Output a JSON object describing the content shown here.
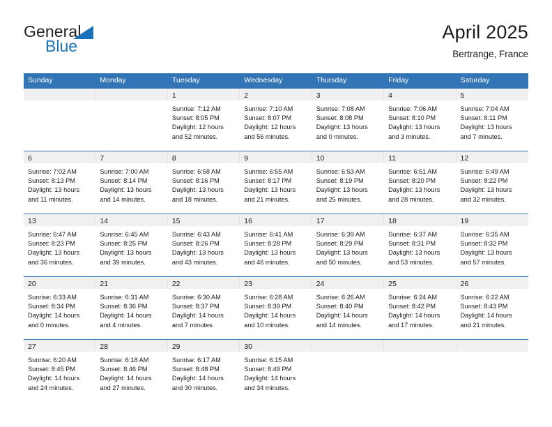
{
  "logo": {
    "primary_text": "General",
    "secondary_text": "Blue",
    "accent_color": "#1b72b8",
    "triangle_icon": "triangle-icon"
  },
  "header": {
    "title": "April 2025",
    "location": "Bertrange, France"
  },
  "theme": {
    "header_blue": "#3275b6",
    "date_band_gray": "#f0f0f0",
    "text_color": "#1a1a1a"
  },
  "calendar": {
    "day_names": [
      "Sunday",
      "Monday",
      "Tuesday",
      "Wednesday",
      "Thursday",
      "Friday",
      "Saturday"
    ],
    "weeks": [
      [
        {
          "date": "",
          "info": ""
        },
        {
          "date": "",
          "info": ""
        },
        {
          "date": "1",
          "info": "Sunrise: 7:12 AM\nSunset: 8:05 PM\nDaylight: 12 hours\nand 52 minutes."
        },
        {
          "date": "2",
          "info": "Sunrise: 7:10 AM\nSunset: 8:07 PM\nDaylight: 12 hours\nand 56 minutes."
        },
        {
          "date": "3",
          "info": "Sunrise: 7:08 AM\nSunset: 8:08 PM\nDaylight: 13 hours\nand 0 minutes."
        },
        {
          "date": "4",
          "info": "Sunrise: 7:06 AM\nSunset: 8:10 PM\nDaylight: 13 hours\nand 3 minutes."
        },
        {
          "date": "5",
          "info": "Sunrise: 7:04 AM\nSunset: 8:11 PM\nDaylight: 13 hours\nand 7 minutes."
        }
      ],
      [
        {
          "date": "6",
          "info": "Sunrise: 7:02 AM\nSunset: 8:13 PM\nDaylight: 13 hours\nand 11 minutes."
        },
        {
          "date": "7",
          "info": "Sunrise: 7:00 AM\nSunset: 8:14 PM\nDaylight: 13 hours\nand 14 minutes."
        },
        {
          "date": "8",
          "info": "Sunrise: 6:58 AM\nSunset: 8:16 PM\nDaylight: 13 hours\nand 18 minutes."
        },
        {
          "date": "9",
          "info": "Sunrise: 6:55 AM\nSunset: 8:17 PM\nDaylight: 13 hours\nand 21 minutes."
        },
        {
          "date": "10",
          "info": "Sunrise: 6:53 AM\nSunset: 8:19 PM\nDaylight: 13 hours\nand 25 minutes."
        },
        {
          "date": "11",
          "info": "Sunrise: 6:51 AM\nSunset: 8:20 PM\nDaylight: 13 hours\nand 28 minutes."
        },
        {
          "date": "12",
          "info": "Sunrise: 6:49 AM\nSunset: 8:22 PM\nDaylight: 13 hours\nand 32 minutes."
        }
      ],
      [
        {
          "date": "13",
          "info": "Sunrise: 6:47 AM\nSunset: 8:23 PM\nDaylight: 13 hours\nand 36 minutes."
        },
        {
          "date": "14",
          "info": "Sunrise: 6:45 AM\nSunset: 8:25 PM\nDaylight: 13 hours\nand 39 minutes."
        },
        {
          "date": "15",
          "info": "Sunrise: 6:43 AM\nSunset: 8:26 PM\nDaylight: 13 hours\nand 43 minutes."
        },
        {
          "date": "16",
          "info": "Sunrise: 6:41 AM\nSunset: 8:28 PM\nDaylight: 13 hours\nand 46 minutes."
        },
        {
          "date": "17",
          "info": "Sunrise: 6:39 AM\nSunset: 8:29 PM\nDaylight: 13 hours\nand 50 minutes."
        },
        {
          "date": "18",
          "info": "Sunrise: 6:37 AM\nSunset: 8:31 PM\nDaylight: 13 hours\nand 53 minutes."
        },
        {
          "date": "19",
          "info": "Sunrise: 6:35 AM\nSunset: 8:32 PM\nDaylight: 13 hours\nand 57 minutes."
        }
      ],
      [
        {
          "date": "20",
          "info": "Sunrise: 6:33 AM\nSunset: 8:34 PM\nDaylight: 14 hours\nand 0 minutes."
        },
        {
          "date": "21",
          "info": "Sunrise: 6:31 AM\nSunset: 8:36 PM\nDaylight: 14 hours\nand 4 minutes."
        },
        {
          "date": "22",
          "info": "Sunrise: 6:30 AM\nSunset: 8:37 PM\nDaylight: 14 hours\nand 7 minutes."
        },
        {
          "date": "23",
          "info": "Sunrise: 6:28 AM\nSunset: 8:39 PM\nDaylight: 14 hours\nand 10 minutes."
        },
        {
          "date": "24",
          "info": "Sunrise: 6:26 AM\nSunset: 8:40 PM\nDaylight: 14 hours\nand 14 minutes."
        },
        {
          "date": "25",
          "info": "Sunrise: 6:24 AM\nSunset: 8:42 PM\nDaylight: 14 hours\nand 17 minutes."
        },
        {
          "date": "26",
          "info": "Sunrise: 6:22 AM\nSunset: 8:43 PM\nDaylight: 14 hours\nand 21 minutes."
        }
      ],
      [
        {
          "date": "27",
          "info": "Sunrise: 6:20 AM\nSunset: 8:45 PM\nDaylight: 14 hours\nand 24 minutes."
        },
        {
          "date": "28",
          "info": "Sunrise: 6:18 AM\nSunset: 8:46 PM\nDaylight: 14 hours\nand 27 minutes."
        },
        {
          "date": "29",
          "info": "Sunrise: 6:17 AM\nSunset: 8:48 PM\nDaylight: 14 hours\nand 30 minutes."
        },
        {
          "date": "30",
          "info": "Sunrise: 6:15 AM\nSunset: 8:49 PM\nDaylight: 14 hours\nand 34 minutes."
        },
        {
          "date": "",
          "info": ""
        },
        {
          "date": "",
          "info": ""
        },
        {
          "date": "",
          "info": ""
        }
      ]
    ]
  }
}
